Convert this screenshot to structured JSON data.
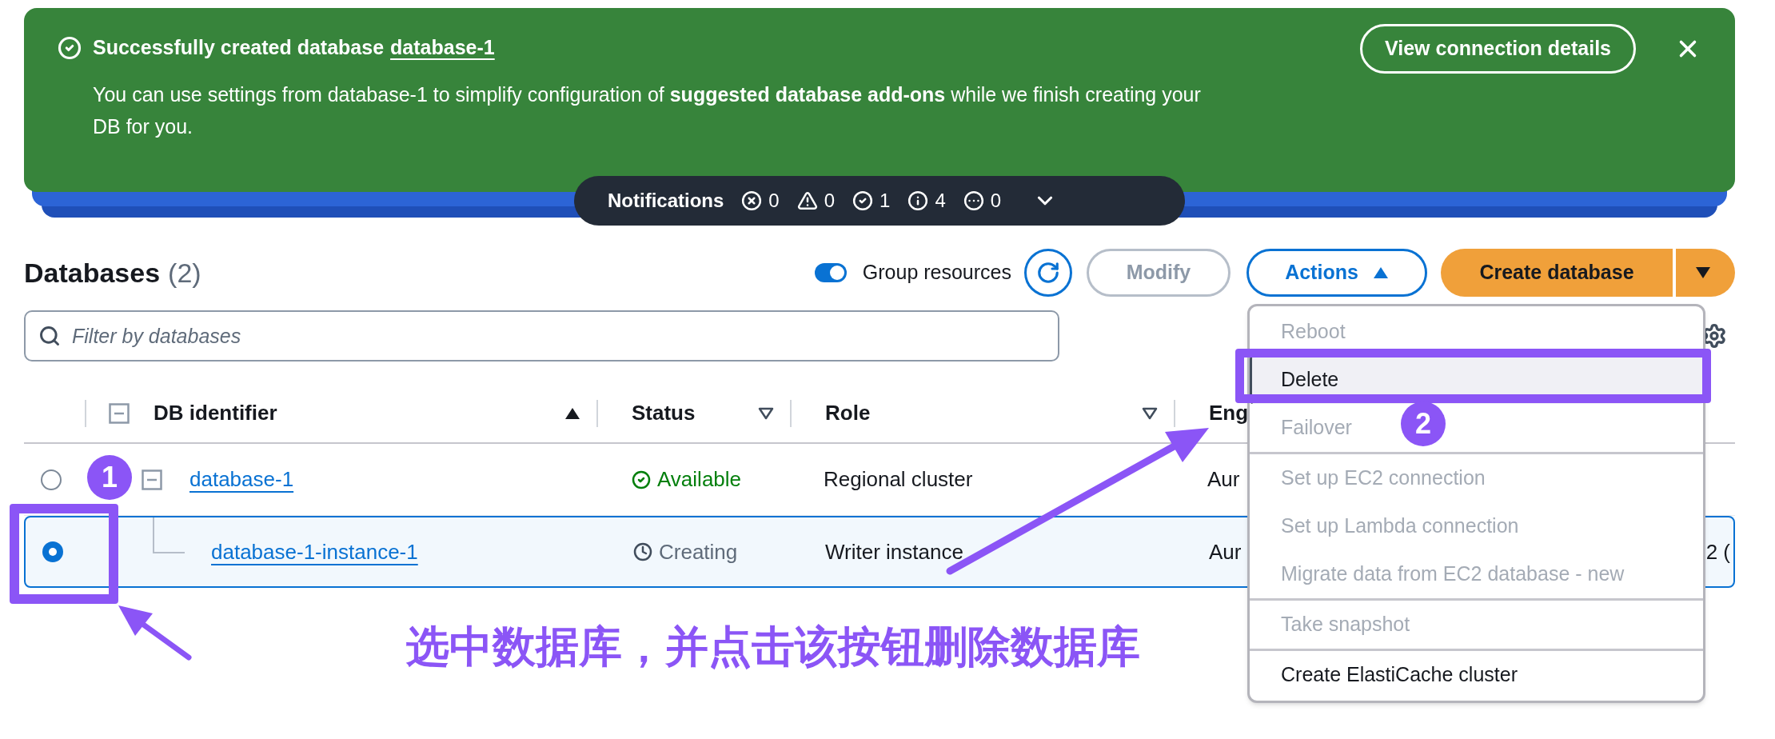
{
  "flash": {
    "title": "Successfully created database",
    "title_link": "database-1",
    "message": "You can use settings from database-1 to simplify configuration of **suggested database add-ons** while we finish creating your DB for you.",
    "button": "View connection details"
  },
  "notifications": {
    "label": "Notifications",
    "counts": [
      {
        "kind": "error",
        "count": "0"
      },
      {
        "kind": "warning",
        "count": "0"
      },
      {
        "kind": "success",
        "count": "1"
      },
      {
        "kind": "info",
        "count": "4"
      },
      {
        "kind": "pending",
        "count": "0"
      }
    ]
  },
  "header": {
    "title": "Databases",
    "count": "(2)",
    "group_toggle": {
      "label": "Group resources",
      "on": true
    },
    "modify": {
      "label": "Modify",
      "disabled": true
    },
    "actions": {
      "label": "Actions",
      "expanded": true
    },
    "create": "Create database"
  },
  "filter": {
    "placeholder": "Filter by databases"
  },
  "table": {
    "columns": [
      {
        "label": "DB identifier",
        "sorted": true
      },
      {
        "label": "Status",
        "sorted": false
      },
      {
        "label": "Role",
        "sorted": false
      },
      {
        "label": "Eng"
      }
    ],
    "rows": [
      {
        "selected": false,
        "expanded": true,
        "identifier": "database-1",
        "status": {
          "kind": "available",
          "text": "Available"
        },
        "role": "Regional cluster",
        "engine": "Aur",
        "children": [
          {
            "selected": true,
            "identifier": "database-1-instance-1",
            "status": {
              "kind": "creating",
              "text": "Creating"
            },
            "role": "Writer instance",
            "engine": "Aur",
            "engine_tail": "2 ("
          }
        ]
      }
    ]
  },
  "menu": {
    "groups": [
      [
        {
          "label": "Reboot",
          "disabled": true,
          "highlighted": false
        },
        {
          "label": "Delete",
          "disabled": false,
          "highlighted": true
        },
        {
          "label": "Failover",
          "disabled": true,
          "highlighted": false
        }
      ],
      [
        {
          "label": "Set up EC2 connection",
          "disabled": true,
          "highlighted": false
        },
        {
          "label": "Set up Lambda connection",
          "disabled": true,
          "highlighted": false
        },
        {
          "label": "Migrate data from EC2 database - new",
          "disabled": true,
          "highlighted": false
        }
      ],
      [
        {
          "label": "Take snapshot",
          "disabled": true,
          "highlighted": false
        }
      ],
      [
        {
          "label": "Create ElastiCache cluster",
          "disabled": false,
          "highlighted": false
        }
      ]
    ]
  },
  "annotations": {
    "steps": [
      "1",
      "2"
    ],
    "caption": "选中数据库，并点击该按钮删除数据库"
  }
}
